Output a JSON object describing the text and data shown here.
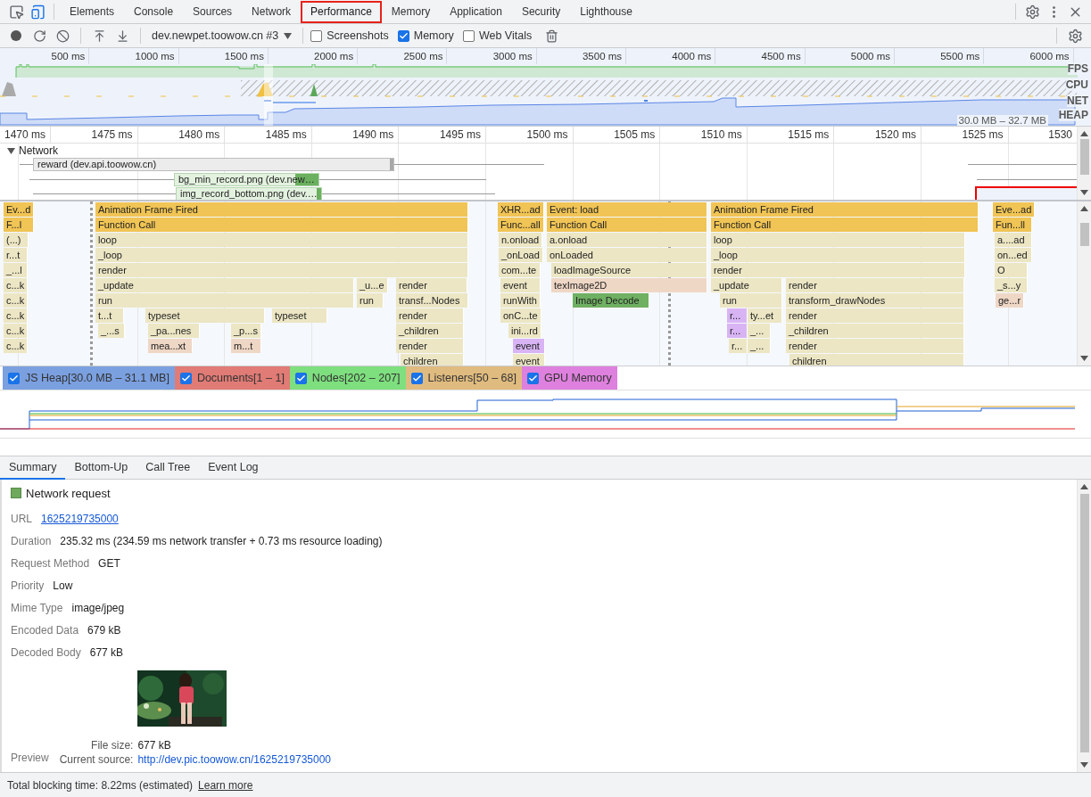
{
  "panel_tabs": [
    {
      "label": "Elements",
      "selected": false
    },
    {
      "label": "Console",
      "selected": false
    },
    {
      "label": "Sources",
      "selected": false
    },
    {
      "label": "Network",
      "selected": false
    },
    {
      "label": "Performance",
      "selected": true
    },
    {
      "label": "Memory",
      "selected": false
    },
    {
      "label": "Application",
      "selected": false
    },
    {
      "label": "Security",
      "selected": false
    },
    {
      "label": "Lighthouse",
      "selected": false
    }
  ],
  "toolbar": {
    "target": "dev.newpet.toowow.cn #3",
    "recording": false,
    "options": [
      {
        "label": "Screenshots",
        "checked": false
      },
      {
        "label": "Memory",
        "checked": true
      },
      {
        "label": "Web Vitals",
        "checked": false
      }
    ]
  },
  "overview": {
    "ticks": [
      "500 ms",
      "1000 ms",
      "1500 ms",
      "2000 ms",
      "2500 ms",
      "3000 ms",
      "3500 ms",
      "4000 ms",
      "4500 ms",
      "5000 ms",
      "5500 ms",
      "6000 ms"
    ],
    "tracks": [
      "FPS",
      "CPU",
      "NET",
      "HEAP"
    ],
    "heap_range": "30.0 MB – 32.7 MB"
  },
  "ruler": {
    "ticks": [
      "1470 ms",
      "1475 ms",
      "1480 ms",
      "1485 ms",
      "1490 ms",
      "1495 ms",
      "1500 ms",
      "1505 ms",
      "1510 ms",
      "1515 ms",
      "1520 ms",
      "1525 ms",
      "1530"
    ]
  },
  "network_track": {
    "title": "Network",
    "expanded": true,
    "requests": [
      {
        "label": "reward (dev.api.toowow.cn)",
        "kind": "xhr"
      },
      {
        "label": "bg_min_record.png (dev.new…"
      },
      {
        "label": "img_record_bottom.png (dev.…"
      }
    ]
  },
  "flame_chart": {
    "blocks": [
      {
        "label": "Ev...d",
        "kind": "event"
      },
      {
        "label": "F...l",
        "kind": "event"
      },
      {
        "label": "(...)",
        "kind": "script"
      },
      {
        "label": "r...t",
        "kind": "script"
      },
      {
        "label": "_...l",
        "kind": "script"
      },
      {
        "label": "c...k",
        "kind": "script"
      },
      {
        "label": "c...k",
        "kind": "script"
      },
      {
        "label": "c...k",
        "kind": "script"
      },
      {
        "label": "c...k",
        "kind": "script"
      },
      {
        "label": "c...k",
        "kind": "script"
      },
      {
        "label": "Animation Frame Fired",
        "kind": "event"
      },
      {
        "label": "Function Call",
        "kind": "event"
      },
      {
        "label": "loop",
        "kind": "script"
      },
      {
        "label": "_loop",
        "kind": "script"
      },
      {
        "label": "render",
        "kind": "script"
      },
      {
        "label": "_update",
        "kind": "script"
      },
      {
        "label": "_u...e",
        "kind": "script"
      },
      {
        "label": "render",
        "kind": "script"
      },
      {
        "label": "run",
        "kind": "script"
      },
      {
        "label": "run",
        "kind": "script"
      },
      {
        "label": "transf...Nodes",
        "kind": "script"
      },
      {
        "label": "t...t",
        "kind": "script"
      },
      {
        "label": "typeset",
        "kind": "script"
      },
      {
        "label": "typeset",
        "kind": "script"
      },
      {
        "label": "render",
        "kind": "script"
      },
      {
        "label": "_...s",
        "kind": "script"
      },
      {
        "label": "_pa...nes",
        "kind": "script"
      },
      {
        "label": "_p...s",
        "kind": "script"
      },
      {
        "label": "_children",
        "kind": "script"
      },
      {
        "label": "mea...xt",
        "kind": "paint"
      },
      {
        "label": "m...t",
        "kind": "paint"
      },
      {
        "label": "render",
        "kind": "script"
      },
      {
        "label": "children",
        "kind": "script"
      },
      {
        "label": "XHR...ad",
        "kind": "event"
      },
      {
        "label": "Func...all",
        "kind": "event"
      },
      {
        "label": "n.onload",
        "kind": "script"
      },
      {
        "label": "_onLoad",
        "kind": "script"
      },
      {
        "label": "com...te",
        "kind": "script"
      },
      {
        "label": "event",
        "kind": "script"
      },
      {
        "label": "runWith",
        "kind": "script"
      },
      {
        "label": "onC...te",
        "kind": "script"
      },
      {
        "label": "ini...rd",
        "kind": "script"
      },
      {
        "label": "event",
        "kind": "layout"
      },
      {
        "label": "event",
        "kind": "script"
      },
      {
        "label": "Event: load",
        "kind": "event"
      },
      {
        "label": "Function Call",
        "kind": "event"
      },
      {
        "label": "a.onload",
        "kind": "script"
      },
      {
        "label": "onLoaded",
        "kind": "script"
      },
      {
        "label": "loadImageSource",
        "kind": "script"
      },
      {
        "label": "texImage2D",
        "kind": "paint"
      },
      {
        "label": "Image Decode",
        "kind": "decode"
      },
      {
        "label": "Animation Frame Fired",
        "kind": "event"
      },
      {
        "label": "Function Call",
        "kind": "event"
      },
      {
        "label": "loop",
        "kind": "script"
      },
      {
        "label": "_loop",
        "kind": "script"
      },
      {
        "label": "render",
        "kind": "script"
      },
      {
        "label": "_update",
        "kind": "script"
      },
      {
        "label": "render",
        "kind": "script"
      },
      {
        "label": "run",
        "kind": "script"
      },
      {
        "label": "transform_drawNodes",
        "kind": "script"
      },
      {
        "label": "r...",
        "kind": "layout"
      },
      {
        "label": "ty...et",
        "kind": "script"
      },
      {
        "label": "render",
        "kind": "script"
      },
      {
        "label": "r...",
        "kind": "layout"
      },
      {
        "label": "_...",
        "kind": "script"
      },
      {
        "label": "_children",
        "kind": "script"
      },
      {
        "label": "r...",
        "kind": "script"
      },
      {
        "label": "_...",
        "kind": "script"
      },
      {
        "label": "render",
        "kind": "script"
      },
      {
        "label": "children",
        "kind": "script"
      },
      {
        "label": "Eve...ad",
        "kind": "event"
      },
      {
        "label": "Fun...ll",
        "kind": "event"
      },
      {
        "label": "a....ad",
        "kind": "script"
      },
      {
        "label": "on...ed",
        "kind": "script"
      },
      {
        "label": "O",
        "kind": "script"
      },
      {
        "label": "_s...y",
        "kind": "script"
      },
      {
        "label": "ge...r",
        "kind": "paint"
      }
    ]
  },
  "counters": [
    {
      "label": "JS Heap[30.0 MB – 31.1 MB]",
      "checked": true,
      "color": "#7ba0e0"
    },
    {
      "label": "Documents[1 – 1]",
      "checked": true,
      "color": "#e07b75"
    },
    {
      "label": "Nodes[202 – 207]",
      "checked": true,
      "color": "#7edf7e"
    },
    {
      "label": "Listeners[50 – 68]",
      "checked": true,
      "color": "#e0bb7f"
    },
    {
      "label": "GPU Memory",
      "checked": true,
      "color": "#de80de"
    }
  ],
  "details_tabs": [
    {
      "label": "Summary",
      "selected": true
    },
    {
      "label": "Bottom-Up",
      "selected": false
    },
    {
      "label": "Call Tree",
      "selected": false
    },
    {
      "label": "Event Log",
      "selected": false
    }
  ],
  "summary": {
    "title": "Network request",
    "rows": [
      {
        "label": "URL",
        "value": "1625219735000",
        "kind": "link"
      },
      {
        "label": "Duration",
        "value": "235.32 ms (234.59 ms network transfer + 0.73 ms resource loading)",
        "kind": "text"
      },
      {
        "label": "Request Method",
        "value": "GET",
        "kind": "text"
      },
      {
        "label": "Priority",
        "value": "Low",
        "kind": "text"
      },
      {
        "label": "Mime Type",
        "value": "image/jpeg",
        "kind": "text"
      },
      {
        "label": "Encoded Data",
        "value": "679 kB",
        "kind": "text"
      },
      {
        "label": "Decoded Body",
        "value": "677 kB",
        "kind": "text"
      }
    ],
    "preview": {
      "label": "Preview",
      "details": [
        {
          "label": "File size:",
          "value": "677 kB",
          "kind": "text"
        },
        {
          "label": "Current source:",
          "value": "http://dev.pic.toowow.cn/1625219735000",
          "kind": "link"
        }
      ]
    }
  },
  "footer": {
    "text": "Total blocking time: 8.22ms (estimated)",
    "link": "Learn more"
  }
}
